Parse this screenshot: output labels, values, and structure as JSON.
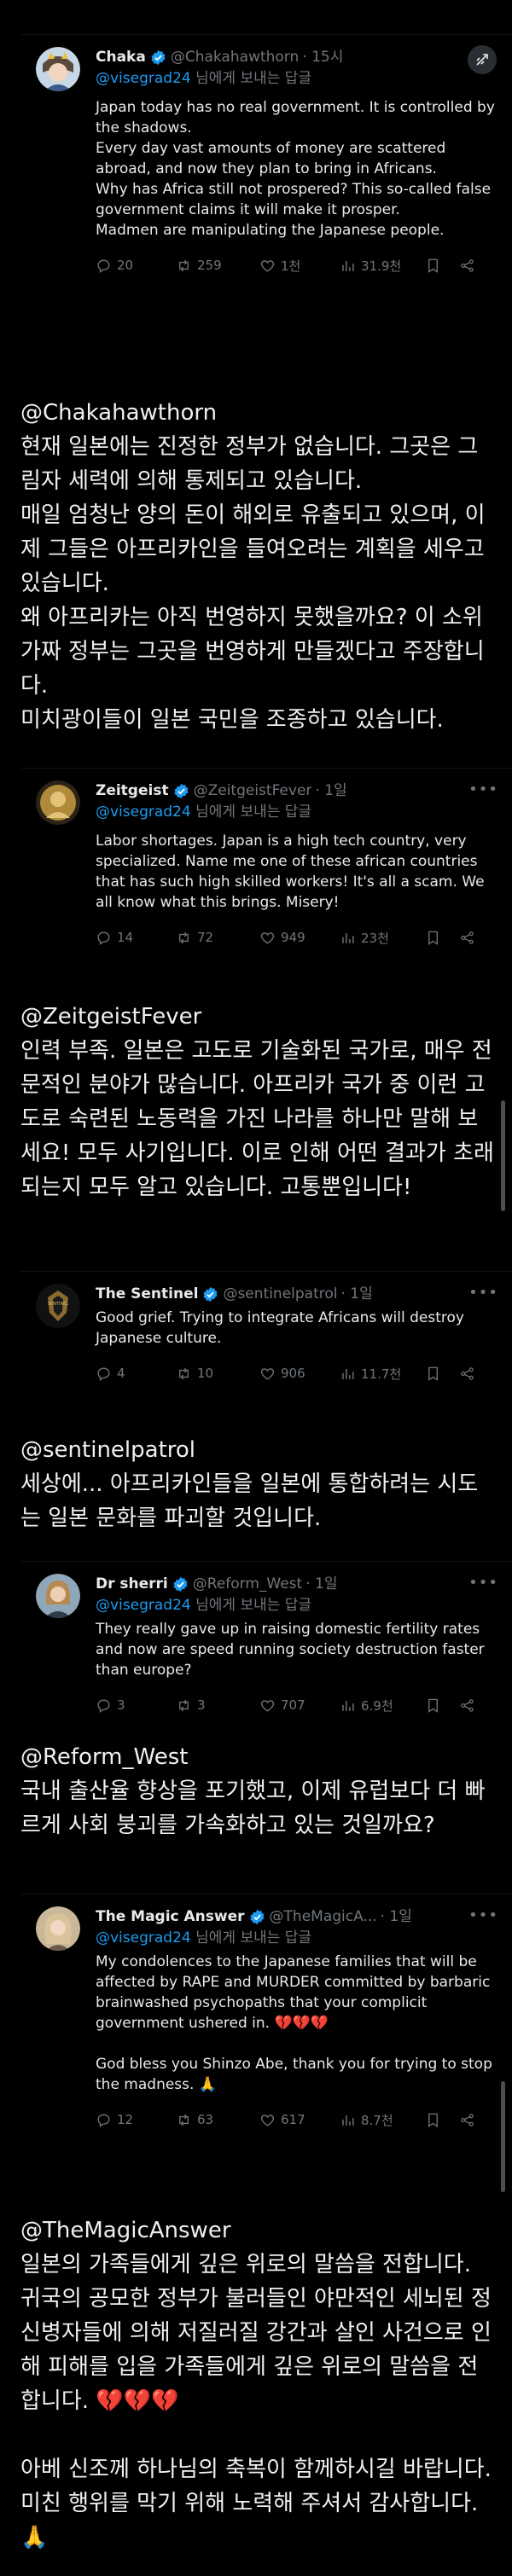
{
  "reply_to_prefix": "@visegrad24",
  "reply_to_suffix": " 님에게 보내는 답글",
  "colors": {
    "background": "#000000",
    "text": "#e7e9ea",
    "muted": "#71767b",
    "accent": "#1d9bf0",
    "verified": "#1d9bf0"
  },
  "tweets": [
    {
      "name": "Chaka",
      "handle": "@Chakahawthorn",
      "time": "· 15시",
      "text": "Japan today has no real government. It is controlled by the shadows.\nEvery day vast amounts of money are scattered abroad, and now they plan to bring in Africans.\nWhy has Africa still not prospered? This so-called false government claims it will make it prosper.\nMadmen are manipulating the Japanese people.",
      "replies": "20",
      "reposts": "259",
      "likes": "1천",
      "views": "31.9천",
      "avatar_icon": "anime-avatar-icon",
      "top_right_icon": "grok-icon"
    },
    {
      "name": "Zeitgeist",
      "handle": "@ZeitgeistFever",
      "time": "· 1일",
      "text": "Labor shortages. Japan is a high tech country, very specialized. Name me one of these african countries that has such high skilled workers! It's all a scam. We all know what this brings. Misery!",
      "replies": "14",
      "reposts": "72",
      "likes": "949",
      "views": "23천",
      "avatar_icon": "golden-portrait-avatar-icon",
      "top_right_icon": "more-icon"
    },
    {
      "name": "The Sentinel",
      "handle": "@sentinelpatrol",
      "time": "· 1일",
      "text": "Good grief. Trying to integrate Africans will destroy  Japanese culture.",
      "replies": "4",
      "reposts": "10",
      "likes": "906",
      "views": "11.7천",
      "avatar_icon": "sentinel-logo-avatar-icon",
      "avatar_text": "SENTINEL",
      "top_right_icon": "more-icon"
    },
    {
      "name": "Dr sherri",
      "handle": "@Reform_West",
      "time": "· 1일",
      "text": "They really gave up in raising domestic fertility rates and now are speed running society destruction faster than europe?",
      "replies": "3",
      "reposts": "3",
      "likes": "707",
      "views": "6.9천",
      "avatar_icon": "woman-portrait-avatar-icon",
      "top_right_icon": "more-icon"
    },
    {
      "name": "The Magic Answer",
      "handle": "@TheMagicA...",
      "time": "· 1일",
      "text": "My condolences to the Japanese families that will be affected by RAPE and MURDER committed by barbaric brainwashed psychopaths that your complicit government ushered in. 💔💔💔\n\nGod bless you Shinzo Abe, thank you for trying to stop the madness. 🙏",
      "replies": "12",
      "reposts": "63",
      "likes": "617",
      "views": "8.7천",
      "avatar_icon": "woman-portrait-avatar-icon",
      "top_right_icon": "more-icon"
    }
  ],
  "translations": [
    {
      "mention": "@Chakahawthorn",
      "text": "현재 일본에는 진정한 정부가 없습니다. 그곳은 그림자 세력에 의해 통제되고 있습니다.\n매일 엄청난 양의 돈이 해외로 유출되고 있으며, 이제 그들은 아프리카인을 들여오려는 계획을 세우고 있습니다.\n왜 아프리카는 아직 번영하지 못했을까요? 이 소위 가짜 정부는 그곳을 번영하게 만들겠다고 주장합니다.\n미치광이들이 일본 국민을 조종하고 있습니다."
    },
    {
      "mention": "@ZeitgeistFever",
      "text": "인력 부족. 일본은 고도로 기술화된 국가로, 매우 전문적인 분야가 많습니다. 아프리카 국가 중 이런 고도로 숙련된 노동력을 가진 나라를 하나만 말해 보세요! 모두 사기입니다. 이로 인해 어떤 결과가 초래되는지 모두 알고 있습니다. 고통뿐입니다!"
    },
    {
      "mention": "@sentinelpatrol",
      "text": "세상에... 아프리카인들을 일본에 통합하려는 시도는 일본 문화를 파괴할 것입니다."
    },
    {
      "mention": "@Reform_West",
      "text": "국내 출산율 향상을 포기했고, 이제 유럽보다 더 빠르게 사회 붕괴를 가속화하고 있는 것일까요?"
    },
    {
      "mention": "@TheMagicAnswer",
      "text": "일본의 가족들에게 깊은 위로의 말씀을 전합니다. 귀국의 공모한 정부가 불러들인 야만적인 세뇌된 정신병자들에 의해 저질러질 강간과 살인 사건으로 인해 피해를 입을 가족들에게 깊은 위로의 말씀을 전합니다. 💔💔💔\n\n아베 신조께 하나님의 축복이 함께하시길 바랍니다. 미친 행위를 막기 위해 노력해 주셔서 감사합니다. 🙏"
    }
  ]
}
